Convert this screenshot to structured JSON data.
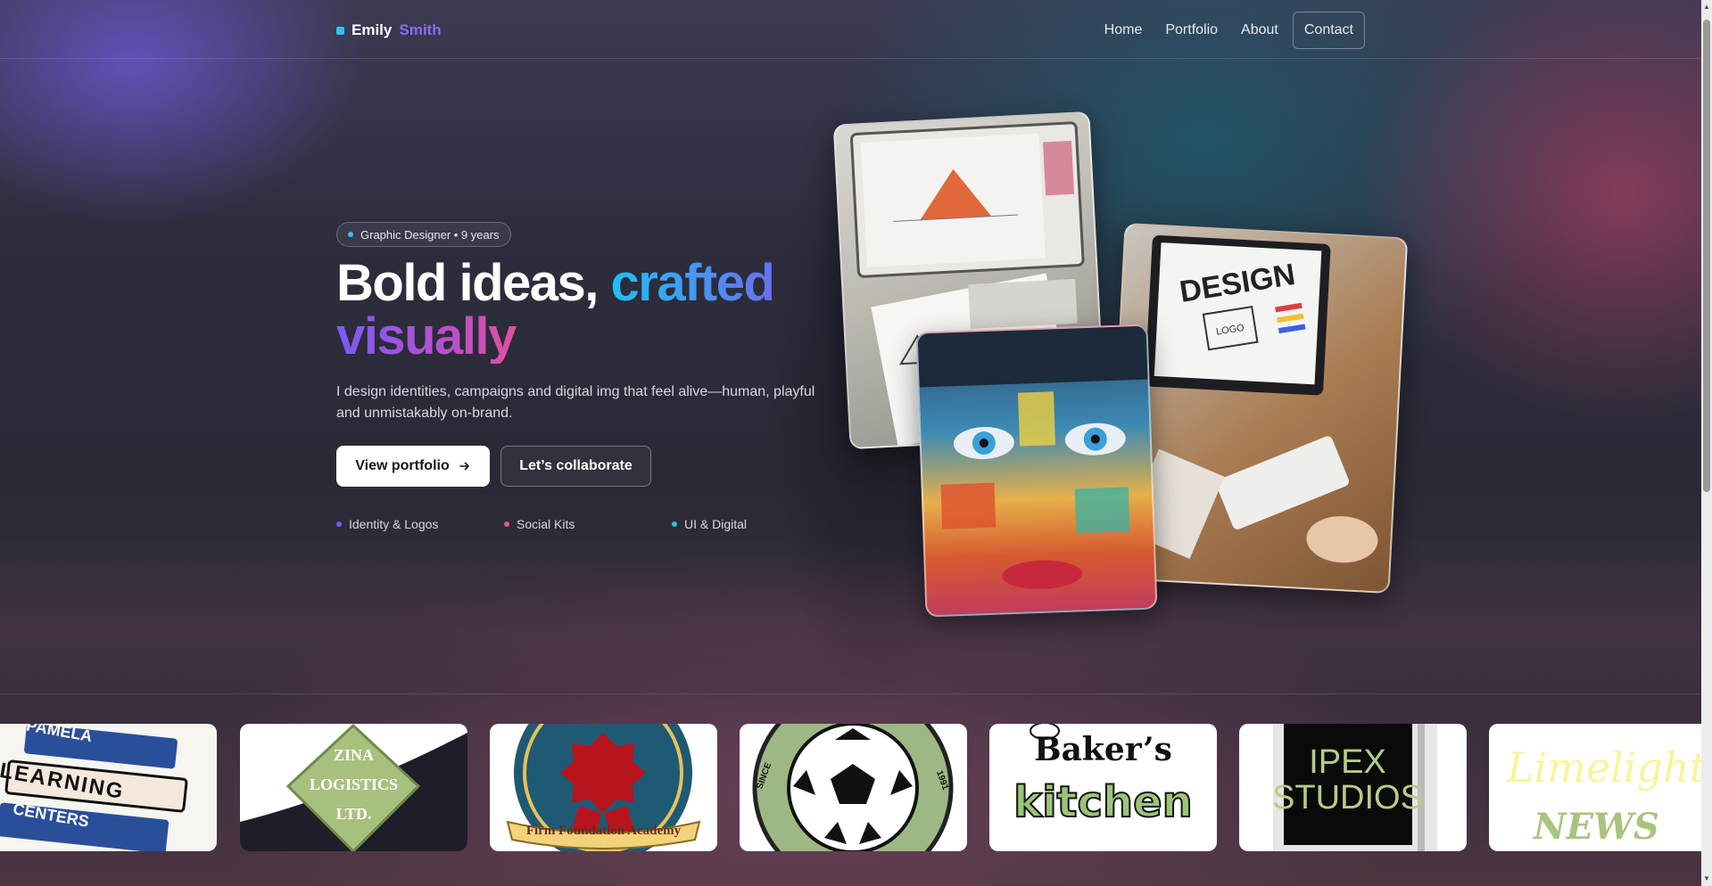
{
  "header": {
    "brand_first": "Emily",
    "brand_last": "Smith",
    "nav": [
      {
        "label": "Home"
      },
      {
        "label": "Portfolio"
      },
      {
        "label": "About"
      },
      {
        "label": "Contact"
      }
    ]
  },
  "hero": {
    "badge": "Graphic Designer • 9 years",
    "headline_part1": "Bold ideas, ",
    "headline_part2": "crafted",
    "headline_part3": "visually",
    "intro": "I design identities, campaigns and digital img that feel alive—human, playful and unmistakably on-brand.",
    "primary_button": "View portfolio",
    "secondary_button": "Let’s collaborate",
    "tags": [
      {
        "label": "Identity & Logos",
        "color": "#7a5af5"
      },
      {
        "label": "Social Kits",
        "color": "#f0508a"
      },
      {
        "label": "UI & Digital",
        "color": "#2ec4f0"
      }
    ],
    "image_b_text": "DESIGN",
    "image_b_sub": "LOGO"
  },
  "logos": [
    {
      "line1": "PAMELA",
      "line2": "LEARNING",
      "line3": "CENTERS"
    },
    {
      "line1": "ZINA",
      "line2": "LOGISTICS",
      "line3": "LTD."
    },
    {
      "line1": "Firm Foundation Academy"
    },
    {
      "line1": "SINCE",
      "line2": "1991"
    },
    {
      "line1": "Baker’s",
      "line2": "kitchen"
    },
    {
      "line1": "IPEX",
      "line2": "STUDIOS"
    },
    {
      "line1": "Limelight",
      "line2": "NEWS"
    }
  ],
  "colors": {
    "accent_cyan": "#2ec4f0",
    "accent_purple": "#7a5af5",
    "accent_pink": "#f0508a"
  }
}
